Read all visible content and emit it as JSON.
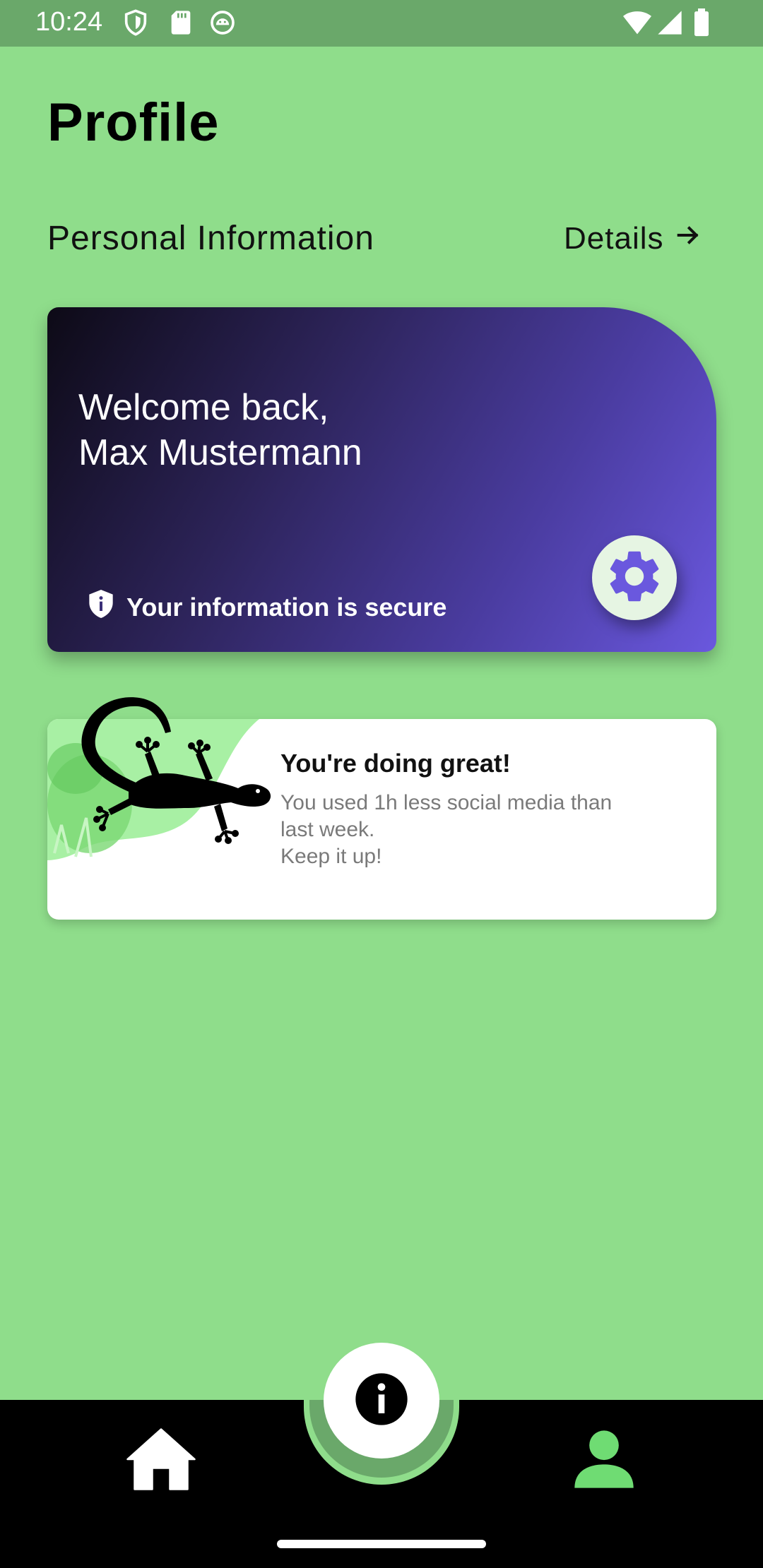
{
  "status_bar": {
    "time": "10:24",
    "left_icons": [
      "shield-icon",
      "sd-card-icon",
      "android-debug-icon"
    ],
    "right_icons": [
      "wifi-icon",
      "signal-icon",
      "battery-icon"
    ]
  },
  "header": {
    "title": "Profile"
  },
  "personal_info": {
    "section_title": "Personal Information",
    "details_label": "Details",
    "details_icon": "arrow-right-icon"
  },
  "welcome_card": {
    "greeting": "Welcome back,",
    "name": "Max Mustermann",
    "secure_text": "Your information is secure",
    "secure_icon": "shield-info-icon",
    "settings_icon": "gear-icon",
    "gradient_start": "#0d0a16",
    "gradient_end": "#6a58de"
  },
  "motivation_card": {
    "heading": "You're doing great!",
    "line1": "You used 1h less social media than",
    "line2": "last week.",
    "line3": "Keep it up!",
    "illustration": "gecko-icon"
  },
  "bottom_nav": {
    "home_icon": "home-icon",
    "info_icon": "info-icon",
    "profile_icon": "person-icon",
    "active_color": "#6fdc73"
  },
  "colors": {
    "background": "#8fdd8b",
    "status_bar": "#6aa86a",
    "nav_bar": "#000000"
  }
}
